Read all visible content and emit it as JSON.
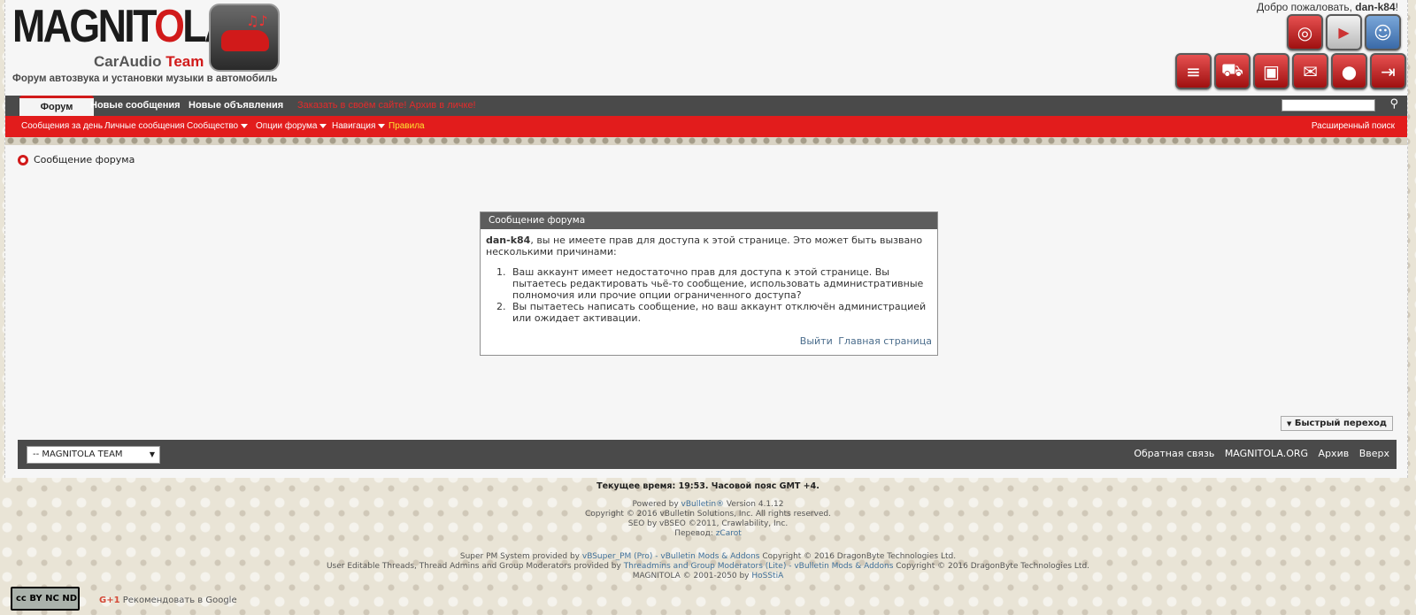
{
  "header": {
    "logo_main": "MAGNIT",
    "logo_o": "O",
    "logo_end": "LA",
    "logo_sub_a": "CarAudio",
    "logo_sub_b": "Team",
    "tagline": "Форум автозвука и установки музыки в автомобиль",
    "welcome_prefix": "Добро пожаловать,",
    "welcome_user": "dan-k84"
  },
  "top_icons": [
    "lifebuoy-icon",
    "multimedia-icon",
    "support-icon"
  ],
  "toolbar_icons": [
    "list-icon",
    "cart-icon",
    "picture-icon",
    "mail-icon",
    "profile-icon",
    "logout-icon"
  ],
  "nav": {
    "tabs": [
      "Форум",
      "Новые сообщения",
      "Новые объявления"
    ],
    "promo": "Заказать в своём сайте! Архив в личке!"
  },
  "subnav": {
    "items": [
      "Сообщения за день",
      "Личные сообщения",
      "Сообщество",
      "Опции форума",
      "Навигация",
      "Правила"
    ],
    "advanced_search": "Расширенный поиск"
  },
  "breadcrumb": {
    "label": "Сообщение форума"
  },
  "message": {
    "title": "Сообщение форума",
    "user": "dan-k84",
    "intro": ", вы не имеете прав для доступа к этой странице. Это может быть вызвано несколькими причинами:",
    "reasons": [
      "Ваш аккаунт имеет недостаточно прав для доступа к этой странице. Вы пытаетесь редактировать чьё-то сообщение, использовать административные полномочия или прочие опции ограниченного доступа?",
      "Вы пытаетесь написать сообщение, но ваш аккаунт отключён администрацией или ожидает активации."
    ],
    "link_logout": "Выйти",
    "link_home": "Главная страница"
  },
  "quick_nav": "Быстрый переход",
  "footer": {
    "style_select": "-- MAGNITOLA TEAM",
    "links": [
      "Обратная связь",
      "MAGNITOLA.ORG",
      "Архив",
      "Вверх"
    ]
  },
  "credits": {
    "time": "Текущее время: 19:53. Часовой пояс GMT +4.",
    "powered_prefix": "Powered by ",
    "powered_link": "vBulletin®",
    "powered_suffix": " Version 4.1.12",
    "copyright": "Copyright © 2016 vBulletin Solutions, Inc. All rights reserved.",
    "seo": "SEO by vBSEO ©2011, Crawlability, Inc.",
    "translation_prefix": "Перевод: ",
    "translation_link": "zCarot",
    "pm_prefix": "Super PM System provided by ",
    "pm_link": "vBSuper_PM (Pro) - vBulletin Mods & Addons",
    "pm_suffix": " Copyright © 2016 DragonByte Technologies Ltd.",
    "threads_prefix": "User Editable Threads, Thread Admins and Group Moderators provided by ",
    "threads_link": "Threadmins and Group Moderators (Lite) - vBulletin Mods & Addons",
    "threads_suffix": " Copyright © 2016 DragonByte Technologies Ltd.",
    "site_prefix": "MAGNITOLA © 2001-2050 by ",
    "site_link": "HoSStiA"
  },
  "cc_badge": "cc BY NC ND",
  "gplus_label": "G+1",
  "gplus_text": "Рекомендовать в Google"
}
